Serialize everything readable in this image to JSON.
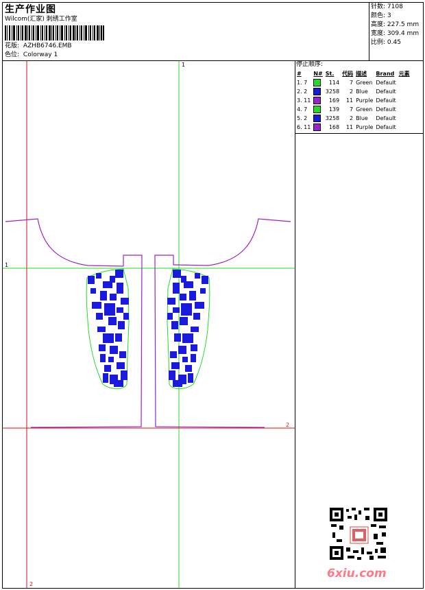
{
  "header": {
    "title": "生产作业图",
    "company": "Wilcom(汇家) 刺绣工作室",
    "design_label": "花版:",
    "design_file": "AZHB6746.EMB",
    "colorway_label": "色位:",
    "colorway": "Colorway 1"
  },
  "stats": {
    "stitches_label": "针数:",
    "stitches": "7108",
    "colors_label": "颜色:",
    "colors": "3",
    "height_label": "高度:",
    "height": "227.5 mm",
    "width_label": "宽度:",
    "width": "309.4 mm",
    "scale_label": "比例:",
    "scale": "0.45"
  },
  "sequence": {
    "title": "停止顺序:",
    "headers": [
      "#",
      "N#",
      "St.",
      "代码",
      "描述",
      "Brand",
      "元素"
    ],
    "rows": [
      {
        "idx": "1. 7",
        "color": "#22dd22",
        "st": "114",
        "code": "7",
        "desc": "Green",
        "brand": "Default"
      },
      {
        "idx": "2. 2",
        "color": "#1a1add",
        "st": "3258",
        "code": "2",
        "desc": "Blue",
        "brand": "Default"
      },
      {
        "idx": "3. 11",
        "color": "#9922cc",
        "st": "169",
        "code": "11",
        "desc": "Purple",
        "brand": "Default"
      },
      {
        "idx": "4. 7",
        "color": "#22dd22",
        "st": "139",
        "code": "7",
        "desc": "Green",
        "brand": "Default"
      },
      {
        "idx": "5. 2",
        "color": "#1a1add",
        "st": "3258",
        "code": "2",
        "desc": "Blue",
        "brand": "Default"
      },
      {
        "idx": "6. 11",
        "color": "#9922cc",
        "st": "168",
        "code": "11",
        "desc": "Purple",
        "brand": "Default"
      }
    ]
  },
  "guides": {
    "top_mark": "1",
    "left_mark": "1",
    "right_mark": "2",
    "bottom_mark": "2"
  },
  "watermark": {
    "text": "6xiu.com"
  },
  "colors": {
    "green": "#22dd22",
    "blue": "#1a1add",
    "purple": "#9922cc",
    "red": "#dd1111"
  }
}
